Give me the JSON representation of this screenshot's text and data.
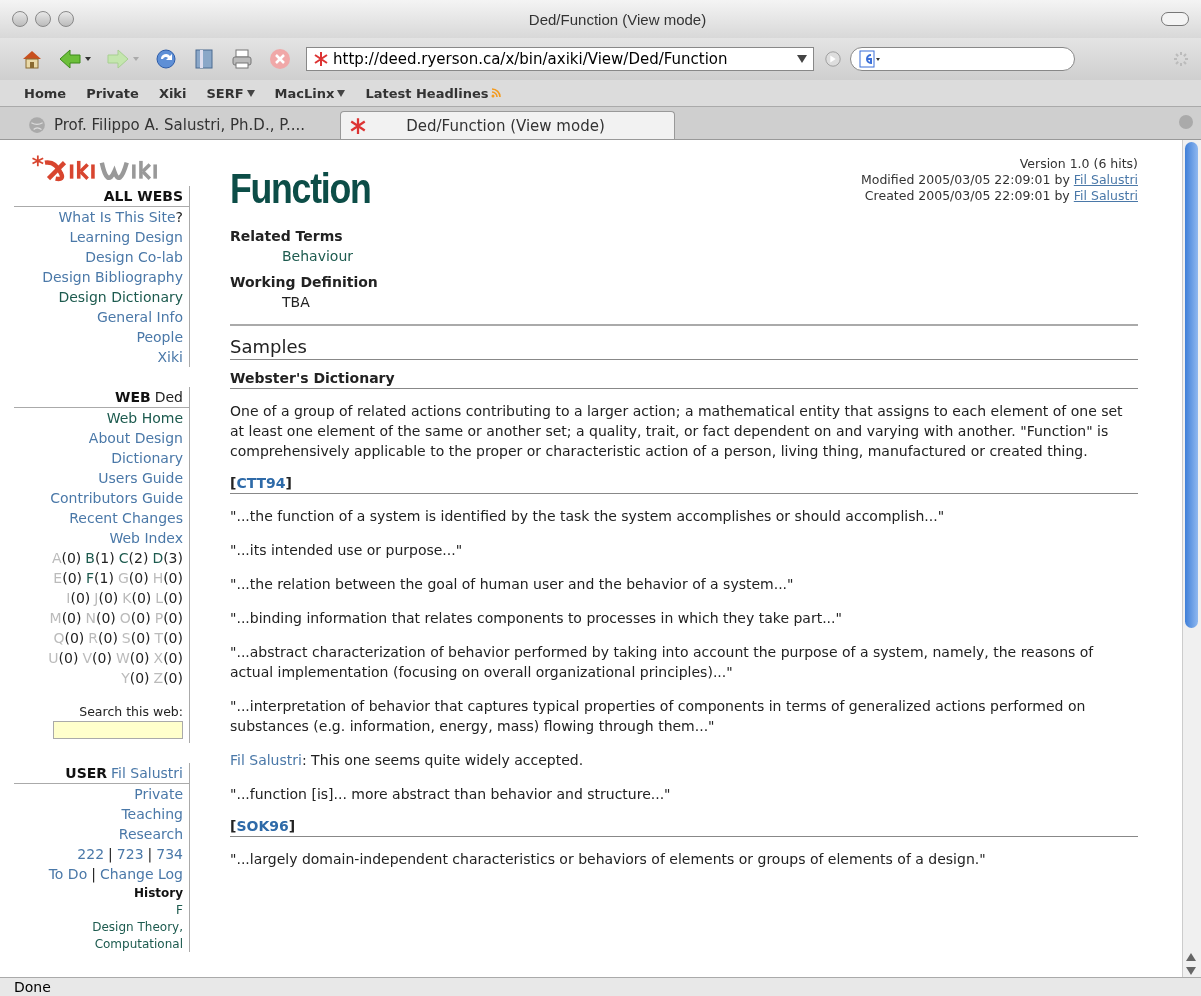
{
  "window": {
    "title": "Ded/Function (View mode)"
  },
  "toolbar": {
    "url": "http://deed.ryerson.ca/x/bin/axiki/View/Ded/Function"
  },
  "bookmarks": [
    {
      "label": "Home",
      "kind": "plain"
    },
    {
      "label": "Private",
      "kind": "plain"
    },
    {
      "label": "Xiki",
      "kind": "plain"
    },
    {
      "label": "SERF",
      "kind": "menu"
    },
    {
      "label": "MacLinx",
      "kind": "menu"
    },
    {
      "label": "Latest Headlines",
      "kind": "feed"
    }
  ],
  "tabs": [
    {
      "label": "Prof. Filippo A. Salustri, Ph.D., P....",
      "selected": false
    },
    {
      "label": "Ded/Function (View mode)",
      "selected": true
    }
  ],
  "sidebar": {
    "sections": [
      {
        "header": {
          "parts": [
            {
              "text": "ALL WEBS",
              "kind": "bold"
            }
          ]
        },
        "rows": [
          {
            "parts": [
              {
                "text": "What Is This Site",
                "kind": "link"
              },
              {
                "text": "?",
                "kind": "plain"
              }
            ]
          },
          {
            "parts": [
              {
                "text": "Learning Design",
                "kind": "link"
              }
            ]
          },
          {
            "parts": [
              {
                "text": "Design Co-lab",
                "kind": "link"
              }
            ]
          },
          {
            "parts": [
              {
                "text": "Design Bibliography",
                "kind": "link"
              }
            ]
          },
          {
            "parts": [
              {
                "text": "Design Dictionary",
                "kind": "current"
              }
            ]
          },
          {
            "parts": [
              {
                "text": "General Info",
                "kind": "link"
              }
            ]
          },
          {
            "parts": [
              {
                "text": "People",
                "kind": "link"
              }
            ]
          },
          {
            "parts": [
              {
                "text": "Xiki",
                "kind": "link"
              }
            ]
          }
        ]
      },
      {
        "header": {
          "parts": [
            {
              "text": "WEB",
              "kind": "bold"
            },
            {
              "text": "Ded",
              "kind": "plain"
            }
          ]
        },
        "rows": [
          {
            "parts": [
              {
                "text": "Web Home",
                "kind": "current"
              }
            ]
          },
          {
            "parts": [
              {
                "text": "About Design",
                "kind": "link"
              }
            ]
          },
          {
            "parts": [
              {
                "text": "Dictionary",
                "kind": "link"
              }
            ]
          },
          {
            "parts": [
              {
                "text": "Users Guide",
                "kind": "link"
              }
            ]
          },
          {
            "parts": [
              {
                "text": "Contributors Guide",
                "kind": "link"
              }
            ]
          },
          {
            "parts": [
              {
                "text": "Recent Changes",
                "kind": "link"
              }
            ]
          },
          {
            "parts": [
              {
                "text": "Web Index",
                "kind": "link"
              }
            ]
          }
        ],
        "index": [
          {
            "entries": [
              {
                "letter": "A",
                "count": "(0)",
                "has": false
              },
              {
                "letter": "B",
                "count": "(1)",
                "has": true
              },
              {
                "letter": "C",
                "count": "(2)",
                "has": true
              },
              {
                "letter": "D",
                "count": "(3)",
                "has": true
              }
            ]
          },
          {
            "entries": [
              {
                "letter": "E",
                "count": "(0)",
                "has": false
              },
              {
                "letter": "F",
                "count": "(1)",
                "has": true
              },
              {
                "letter": "G",
                "count": "(0)",
                "has": false
              },
              {
                "letter": "H",
                "count": "(0)",
                "has": false
              }
            ]
          },
          {
            "entries": [
              {
                "letter": "I",
                "count": "(0)",
                "has": false
              },
              {
                "letter": "J",
                "count": "(0)",
                "has": false
              },
              {
                "letter": "K",
                "count": "(0)",
                "has": false
              },
              {
                "letter": "L",
                "count": "(0)",
                "has": false
              }
            ]
          },
          {
            "entries": [
              {
                "letter": "M",
                "count": "(0)",
                "has": false
              },
              {
                "letter": "N",
                "count": "(0)",
                "has": false
              },
              {
                "letter": "O",
                "count": "(0)",
                "has": false
              },
              {
                "letter": "P",
                "count": "(0)",
                "has": false
              }
            ]
          },
          {
            "entries": [
              {
                "letter": "Q",
                "count": "(0)",
                "has": false
              },
              {
                "letter": "R",
                "count": "(0)",
                "has": false
              },
              {
                "letter": "S",
                "count": "(0)",
                "has": false
              },
              {
                "letter": "T",
                "count": "(0)",
                "has": false
              }
            ]
          },
          {
            "entries": [
              {
                "letter": "U",
                "count": "(0)",
                "has": false
              },
              {
                "letter": "V",
                "count": "(0)",
                "has": false
              },
              {
                "letter": "W",
                "count": "(0)",
                "has": false
              },
              {
                "letter": "X",
                "count": "(0)",
                "has": false
              }
            ]
          },
          {
            "entries": [
              {
                "letter": "Y",
                "count": "(0)",
                "has": false
              },
              {
                "letter": "Z",
                "count": "(0)",
                "has": false
              }
            ]
          }
        ],
        "search_label": "Search this web:"
      },
      {
        "header": {
          "parts": [
            {
              "text": "USER",
              "kind": "bold"
            },
            {
              "text": "Fil Salustri",
              "kind": "link"
            }
          ]
        },
        "rows": [
          {
            "parts": [
              {
                "text": "Private",
                "kind": "link"
              }
            ]
          },
          {
            "parts": [
              {
                "text": "Teaching",
                "kind": "link"
              }
            ]
          },
          {
            "parts": [
              {
                "text": "Research",
                "kind": "link"
              }
            ]
          },
          {
            "parts": [
              {
                "text": "222",
                "kind": "link"
              },
              {
                "text": "|",
                "kind": "plain"
              },
              {
                "text": "723",
                "kind": "link"
              },
              {
                "text": "|",
                "kind": "plain"
              },
              {
                "text": "734",
                "kind": "link"
              }
            ]
          },
          {
            "parts": [
              {
                "text": "To Do",
                "kind": "link"
              },
              {
                "text": "|",
                "kind": "plain"
              },
              {
                "text": "Change Log",
                "kind": "link"
              }
            ]
          },
          {
            "parts": [
              {
                "text": "History",
                "kind": "small-bold"
              }
            ]
          },
          {
            "parts": [
              {
                "text": "F",
                "kind": "small-current"
              }
            ]
          },
          {
            "parts": [
              {
                "text": "Design Theory,",
                "kind": "small-current"
              }
            ]
          },
          {
            "parts": [
              {
                "text": "Computational",
                "kind": "small-current"
              }
            ]
          }
        ]
      }
    ]
  },
  "page": {
    "title": "Function",
    "meta": [
      {
        "parts": [
          {
            "text": "Version 1.0 (6 hits)",
            "kind": "plain"
          }
        ]
      },
      {
        "parts": [
          {
            "text": "Modified 2005/03/05 22:09:01 by",
            "kind": "plain"
          },
          {
            "text": "Fil Salustri",
            "kind": "link"
          }
        ]
      },
      {
        "parts": [
          {
            "text": "Created 2005/03/05 22:09:01 by",
            "kind": "plain"
          },
          {
            "text": "Fil Salustri",
            "kind": "link"
          }
        ]
      }
    ],
    "terms": [
      {
        "term": "Related Terms",
        "value": "Behaviour",
        "kind": "link"
      },
      {
        "term": "Working Definition",
        "value": "TBA",
        "kind": "plain"
      }
    ],
    "samples_heading": "Samples",
    "sources": [
      {
        "name": "Webster's Dictionary",
        "kind": "plain",
        "paragraphs": [
          {
            "parts": [
              {
                "text": "One of a group of related actions contributing to a larger action; a mathematical entity that assigns to each element of one set at least one element of the same or another set; a quality, trait, or fact dependent on and varying with another. \"Function\" is comprehensively applicable to the proper or characteristic action of a person, living thing, manufactured or created thing.",
                "kind": "plain"
              }
            ]
          }
        ]
      },
      {
        "open": "[",
        "name": "CTT94",
        "close": "]",
        "kind": "link",
        "paragraphs": [
          {
            "parts": [
              {
                "text": "\"...the function of a system is identified by the task the system accomplishes or should accomplish...\"",
                "kind": "plain"
              }
            ]
          },
          {
            "parts": [
              {
                "text": "\"...its intended use or purpose...\"",
                "kind": "plain"
              }
            ]
          },
          {
            "parts": [
              {
                "text": "\"...the relation between the goal of human user and the behavior of a system...\"",
                "kind": "plain"
              }
            ]
          },
          {
            "parts": [
              {
                "text": "\"...binding information that relates components to processes in which they take part...\"",
                "kind": "plain"
              }
            ]
          },
          {
            "parts": [
              {
                "text": "\"...abstract characterization of behavior performed by taking into account the purpose of a system, namely, the reasons of actual implementation (focusing on overall organizational principles)...\"",
                "kind": "plain"
              }
            ]
          },
          {
            "parts": [
              {
                "text": "\"...interpretation of behavior that captures typical properties of components in terms of generalized actions performed on substances (e.g. information, energy, mass) flowing through them...\"",
                "kind": "plain"
              }
            ]
          },
          {
            "parts": [
              {
                "text": "Fil Salustri",
                "kind": "link"
              },
              {
                "text": ": This one seems quite widely accepted.",
                "kind": "plain"
              }
            ]
          },
          {
            "parts": [
              {
                "text": "\"...function [is]... more abstract than behavior and structure...\"",
                "kind": "plain"
              }
            ]
          }
        ]
      },
      {
        "open": "[",
        "name": "SOK96",
        "close": "]",
        "kind": "link",
        "paragraphs": [
          {
            "parts": [
              {
                "text": "\"...largely domain-independent characteristics or behaviors of elements or groups of elements of a design.\"",
                "kind": "plain"
              }
            ]
          }
        ]
      }
    ]
  },
  "status_bar": {
    "text": "Done"
  }
}
